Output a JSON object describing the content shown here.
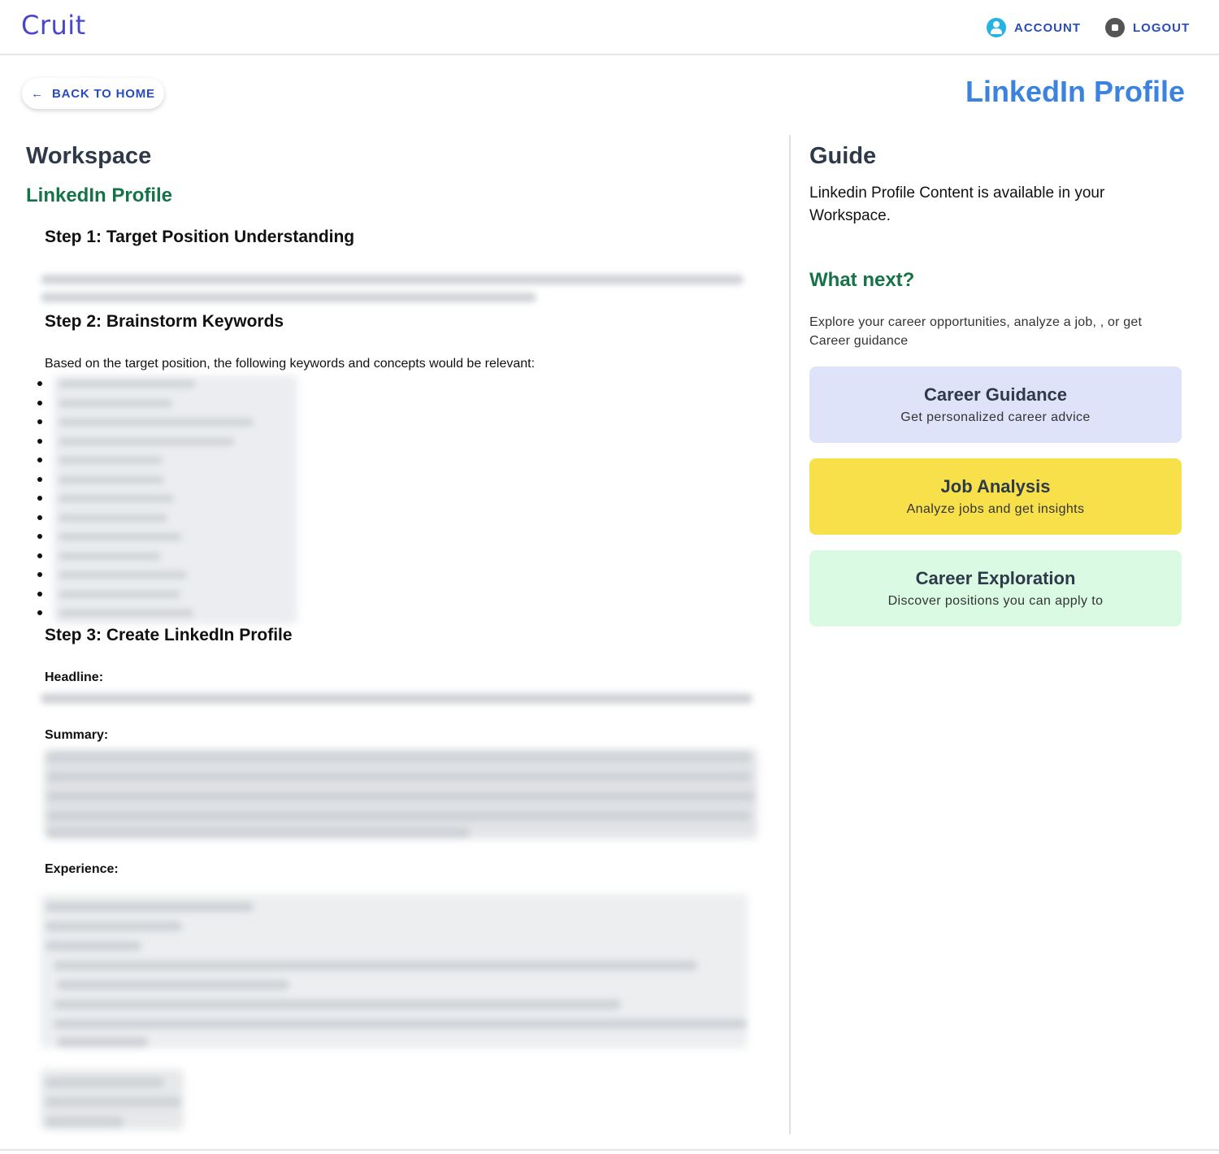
{
  "app": {
    "logo": "Cruit"
  },
  "nav": {
    "account_label": "ACCOUNT",
    "logout_label": "LOGOUT"
  },
  "back_button": {
    "arrow": "←",
    "label": "BACK TO HOME"
  },
  "page_title": "LinkedIn Profile",
  "workspace": {
    "title": "Workspace",
    "subtitle": "LinkedIn Profile",
    "step1": {
      "heading": "Step 1: Target Position Understanding"
    },
    "step2": {
      "heading": "Step 2: Brainstorm Keywords",
      "intro": "Based on the target position, the following keywords and concepts would be relevant:"
    },
    "step3": {
      "heading": "Step 3: Create LinkedIn Profile",
      "headline_label": "Headline:",
      "summary_label": "Summary:",
      "experience_label": "Experience:"
    }
  },
  "guide": {
    "title": "Guide",
    "text": "Linkedin Profile Content is available in your Workspace.",
    "what_next": "What next?",
    "explore": "Explore your career opportunities, analyze a job, , or get Career guidance",
    "cards": [
      {
        "title": "Career Guidance",
        "subtitle": "Get personalized career advice",
        "color": "#dfe3fa"
      },
      {
        "title": "Job Analysis",
        "subtitle": "Analyze jobs and get insights",
        "color": "#f8e04a"
      },
      {
        "title": "Career Exploration",
        "subtitle": "Discover positions you can apply to",
        "color": "#dbfae4"
      }
    ]
  },
  "colors": {
    "brand": "#4a46c8",
    "accent_blue": "#2a4bbd",
    "title_blue": "#3c83e0",
    "green": "#157347"
  },
  "icons": {
    "account": "account-circle-icon",
    "logout": "stop-circle-icon",
    "back": "arrow-left-icon"
  }
}
